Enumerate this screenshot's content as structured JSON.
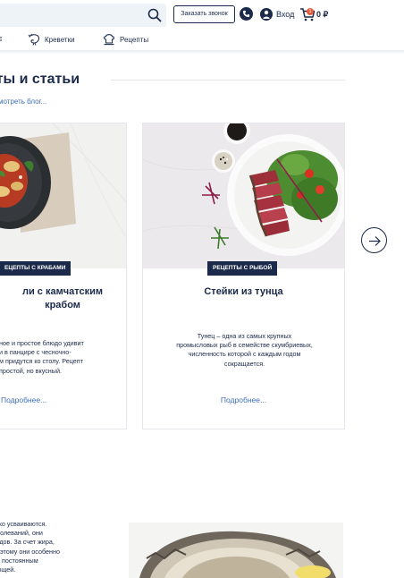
{
  "header": {
    "callback_label": "Заказать звонок",
    "login_label": "Вход",
    "cart_count": "1",
    "cart_total": "0 ₽"
  },
  "nav": {
    "items": [
      {
        "label": "Креветки",
        "icon": "shrimp-icon"
      },
      {
        "label": "Рецепты",
        "icon": "chef-hat-icon"
      }
    ]
  },
  "section": {
    "title": "пты и статьи",
    "blog_link": "мотреть блог..."
  },
  "cards": [
    {
      "tag": "ЕЦЕПТЫ С КРАБАМИ",
      "title_line1": "ли с камчатским",
      "title_line2": "крабом",
      "text": [
        "ное и простое блюдо удивит",
        "и в панцире с чесночно-",
        "м придутся ко столу. Рецепт",
        "простой, но вкусный."
      ],
      "more": "Подробнее..."
    },
    {
      "tag": "РЕЦЕПТЫ С РЫБОЙ",
      "title": "Стейки из тунца",
      "text": [
        "Тунец – одна из самых крупных",
        "промысловых рыб в семействе скумбриевых,",
        "численность которой с каждым годом",
        "сокращается."
      ],
      "more": "Подробнее..."
    }
  ],
  "bottom": {
    "text": [
      "гко усваиваются.",
      "болеваний, они",
      "удов. За счет жира,",
      "оэтому они особенно",
      "и постоянным",
      "ющей."
    ]
  },
  "colors": {
    "navy": "#1b2a4a",
    "link": "#3f6fb8",
    "badge": "#e35d3a"
  }
}
